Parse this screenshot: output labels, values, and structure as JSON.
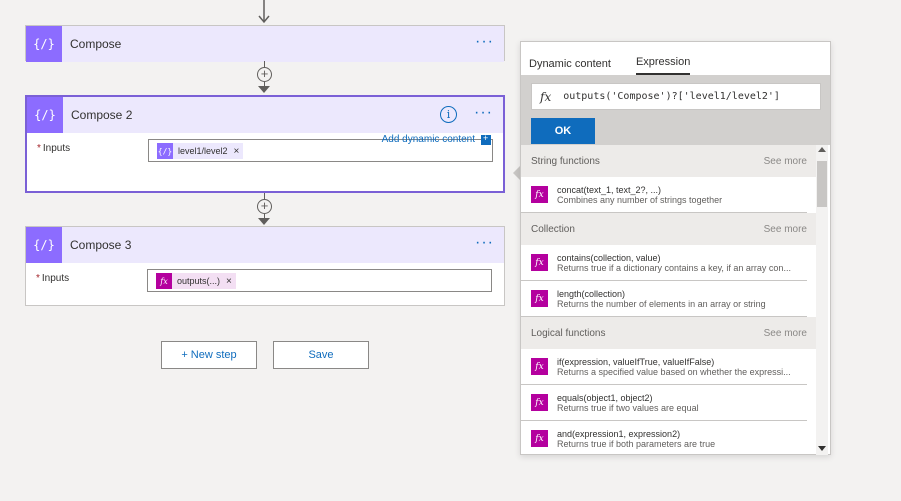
{
  "cards": [
    {
      "title": "Compose",
      "icon": "{/}"
    },
    {
      "title": "Compose 2",
      "icon": "{/}",
      "input_label": "Inputs",
      "required": "*",
      "token_label": "level1/level2",
      "token_close": "×",
      "add_dynamic": "Add dynamic content",
      "info": "i"
    },
    {
      "title": "Compose 3",
      "icon": "{/}",
      "input_label": "Inputs",
      "required": "*",
      "token_label": "outputs(...)",
      "token_close": "×"
    }
  ],
  "menu_dots": "···",
  "plus": "+",
  "buttons": {
    "new_step": "+ New step",
    "save": "Save"
  },
  "panel": {
    "tabs": [
      "Dynamic content",
      "Expression"
    ],
    "active_tab": "Expression",
    "fx": "fx",
    "expression": "outputs('Compose')?['level1/level2']",
    "ok": "OK",
    "sections": [
      {
        "title": "String functions",
        "see_more": "See more",
        "items": [
          {
            "name": "concat(text_1, text_2?, ...)",
            "desc": "Combines any number of strings together"
          }
        ]
      },
      {
        "title": "Collection",
        "see_more": "See more",
        "items": [
          {
            "name": "contains(collection, value)",
            "desc": "Returns true if a dictionary contains a key, if an array con..."
          },
          {
            "name": "length(collection)",
            "desc": "Returns the number of elements in an array or string"
          }
        ]
      },
      {
        "title": "Logical functions",
        "see_more": "See more",
        "items": [
          {
            "name": "if(expression, valueIfTrue, valueIfFalse)",
            "desc": "Returns a specified value based on whether the expressi..."
          },
          {
            "name": "equals(object1, object2)",
            "desc": "Returns true if two values are equal"
          },
          {
            "name": "and(expression1, expression2)",
            "desc": "Returns true if both parameters are true"
          }
        ]
      }
    ]
  },
  "colors": {
    "accent": "#0f6cbd",
    "compose_purple": "#8c6cff",
    "header_lavender": "#ece8fd",
    "expression_magenta": "#b4009e"
  }
}
